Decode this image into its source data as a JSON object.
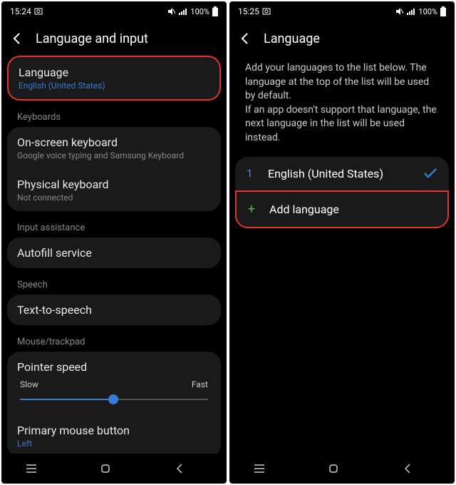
{
  "left": {
    "status": {
      "time": "15:24",
      "battery": "100%"
    },
    "header": {
      "title": "Language and input"
    },
    "items": {
      "language": {
        "title": "Language",
        "sub": "English (United States)"
      },
      "keyboards_label": "Keyboards",
      "onscreen": {
        "title": "On-screen keyboard",
        "sub": "Google voice typing and Samsung Keyboard"
      },
      "physical": {
        "title": "Physical keyboard",
        "sub": "Not connected"
      },
      "input_assist_label": "Input assistance",
      "autofill": {
        "title": "Autofill service"
      },
      "speech_label": "Speech",
      "tts": {
        "title": "Text-to-speech"
      },
      "mouse_label": "Mouse/trackpad",
      "pointer": {
        "title": "Pointer speed",
        "slow": "Slow",
        "fast": "Fast"
      },
      "primary_mouse": {
        "title": "Primary mouse button",
        "sub": "Left"
      }
    }
  },
  "right": {
    "status": {
      "time": "15:25",
      "battery": "100%"
    },
    "header": {
      "title": "Language"
    },
    "description": "Add your languages to the list below. The language at the top of the list will be used by default.\nIf an app doesn't support that language, the next language in the list will be used instead.",
    "langs": [
      {
        "num": "1",
        "name": "English (United States)",
        "checked": true
      }
    ],
    "add": {
      "label": "Add language"
    }
  }
}
